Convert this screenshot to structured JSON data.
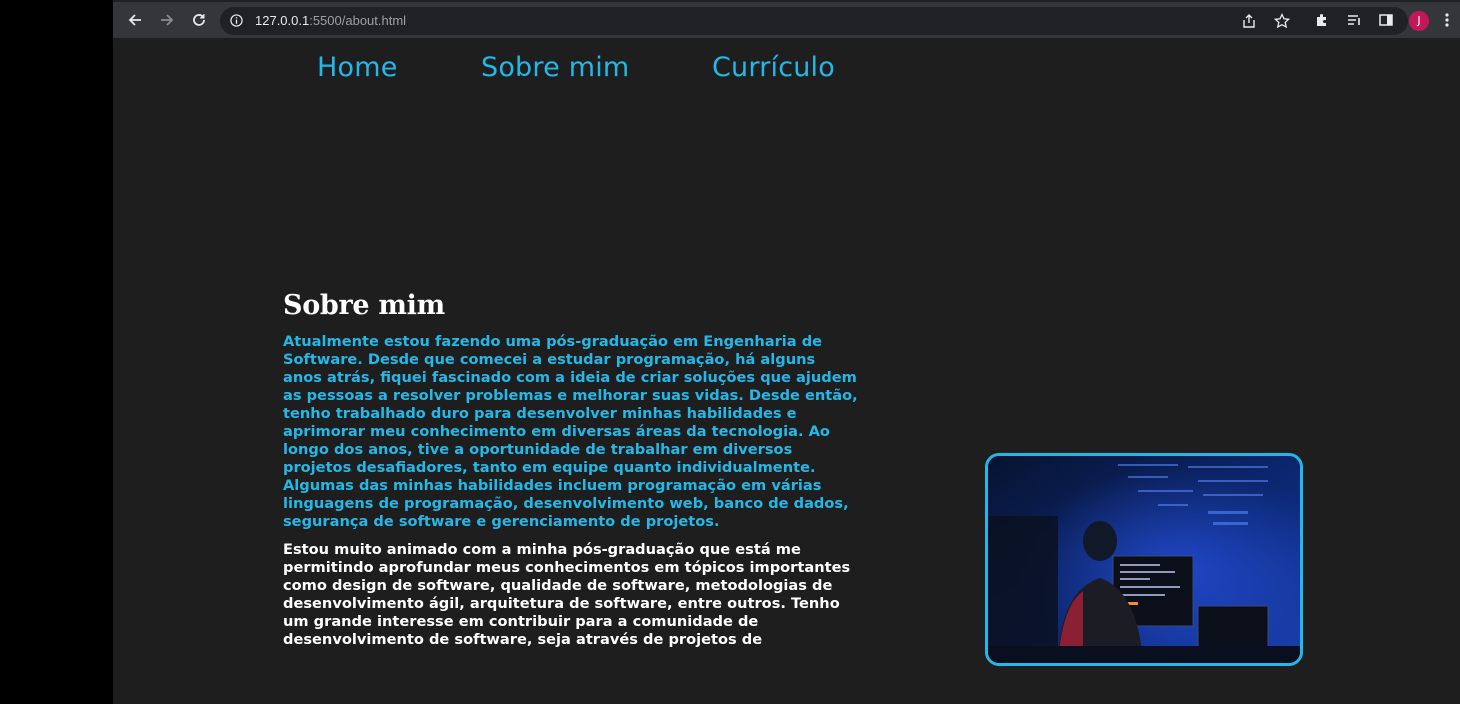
{
  "browser": {
    "url_host": "127.0.0.1",
    "url_path": ":5500/about.html",
    "profile_initial": "J"
  },
  "nav": {
    "items": [
      "Home",
      "Sobre mim",
      "Currículo"
    ]
  },
  "about": {
    "title": "Sobre mim",
    "paragraph1": "Atualmente estou fazendo uma pós-graduação em Engenharia de Software. Desde que comecei a estudar programação, há alguns anos atrás, fiquei fascinado com a ideia de criar soluções que ajudem as pessoas a resolver problemas e melhorar suas vidas. Desde então, tenho trabalhado duro para desenvolver minhas habilidades e aprimorar meu conhecimento em diversas áreas da tecnologia. Ao longo dos anos, tive a oportunidade de trabalhar em diversos projetos desafiadores, tanto em equipe quanto individualmente. Algumas das minhas habilidades incluem programação em várias linguagens de programação, desenvolvimento web, banco de dados, segurança de software e gerenciamento de projetos.",
    "paragraph2": "Estou muito animado com a minha pós-graduação que está me permitindo aprofundar meus conhecimentos em tópicos importantes como design de software, qualidade de software, metodologias de desenvolvimento ágil, arquitetura de software, entre outros. Tenho um grande interesse em contribuir para a comunidade de desenvolvimento de software, seja através de projetos de"
  },
  "colors": {
    "accent": "#23b8e8",
    "page_bg": "#1e1e1e",
    "toolbar_bg": "#35363a"
  }
}
